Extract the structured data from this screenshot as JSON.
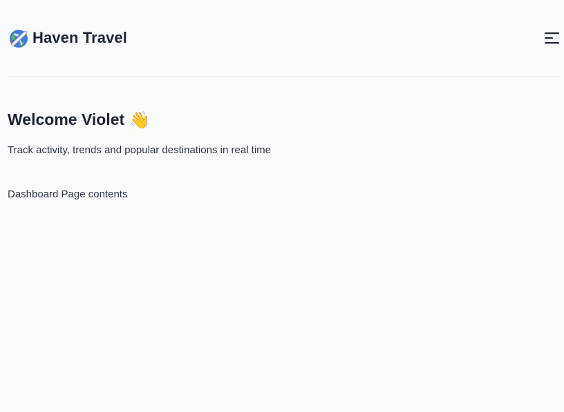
{
  "header": {
    "brand_name": "Haven Travel",
    "logo_icon": "globe-airplane-icon",
    "menu_icon": "menu-toggle-icon"
  },
  "main": {
    "welcome_text": "Welcome Violet",
    "welcome_emoji": "👋",
    "subtitle": "Track activity, trends and popular destinations in real time",
    "page_contents": "Dashboard Page contents"
  },
  "colors": {
    "background": "#fafbfd",
    "text": "#1c2434",
    "divider": "#e8eaef"
  }
}
